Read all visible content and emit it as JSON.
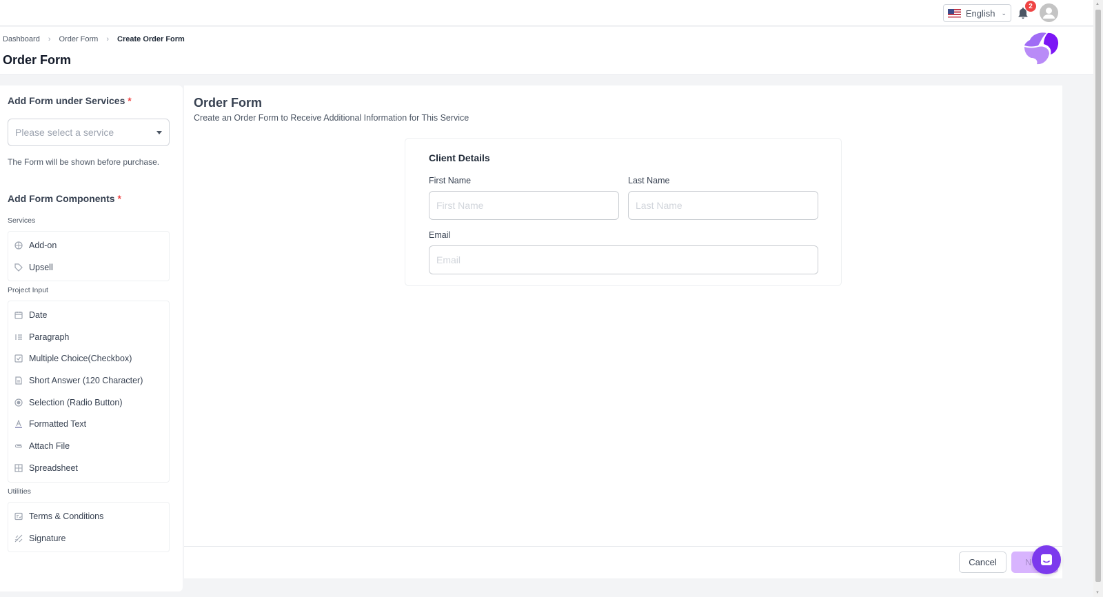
{
  "topbar": {
    "language": "English",
    "language_flag": "us-flag-icon",
    "notification_count": "2"
  },
  "breadcrumb": [
    {
      "label": "Dashboard"
    },
    {
      "label": "Order Form"
    },
    {
      "label": "Create Order Form"
    }
  ],
  "page_title": "Order Form",
  "left_panel": {
    "service_section_title": "Add Form under Services",
    "required_mark": "*",
    "service_select_placeholder": "Please select a service",
    "service_hint": "The Form will be shown before purchase.",
    "components_title": "Add Form Components",
    "groups": [
      {
        "label": "Services",
        "items": [
          {
            "label": "Add-on",
            "icon": "add-on-icon"
          },
          {
            "label": "Upsell",
            "icon": "tag-icon"
          }
        ]
      },
      {
        "label": "Project Input",
        "items": [
          {
            "label": "Date",
            "icon": "calendar-icon"
          },
          {
            "label": "Paragraph",
            "icon": "list-icon"
          },
          {
            "label": "Multiple Choice(Checkbox)",
            "icon": "checkbox-icon"
          },
          {
            "label": "Short Answer (120 Character)",
            "icon": "document-icon"
          },
          {
            "label": "Selection (Radio Button)",
            "icon": "radio-icon"
          },
          {
            "label": "Formatted Text",
            "icon": "text-format-icon"
          },
          {
            "label": "Attach File",
            "icon": "paperclip-icon"
          },
          {
            "label": "Spreadsheet",
            "icon": "table-icon"
          }
        ]
      },
      {
        "label": "Utilities",
        "items": [
          {
            "label": "Terms & Conditions",
            "icon": "terms-icon"
          },
          {
            "label": "Signature",
            "icon": "signature-icon"
          }
        ]
      }
    ]
  },
  "main": {
    "title": "Order Form",
    "subtitle": "Create an Order Form to Receive Additional Information for This Service",
    "card": {
      "title": "Client Details",
      "first_name_label": "First Name",
      "first_name_placeholder": "First Name",
      "first_name_value": "",
      "last_name_label": "Last Name",
      "last_name_placeholder": "Last Name",
      "last_name_value": "",
      "email_label": "Email",
      "email_placeholder": "Email",
      "email_value": ""
    },
    "cancel_label": "Cancel",
    "next_label": "N"
  },
  "colors": {
    "accent": "#7c3aed",
    "next_button_disabled": "#d8b4fe",
    "required": "#ef4444",
    "badge": "#ef4444"
  }
}
